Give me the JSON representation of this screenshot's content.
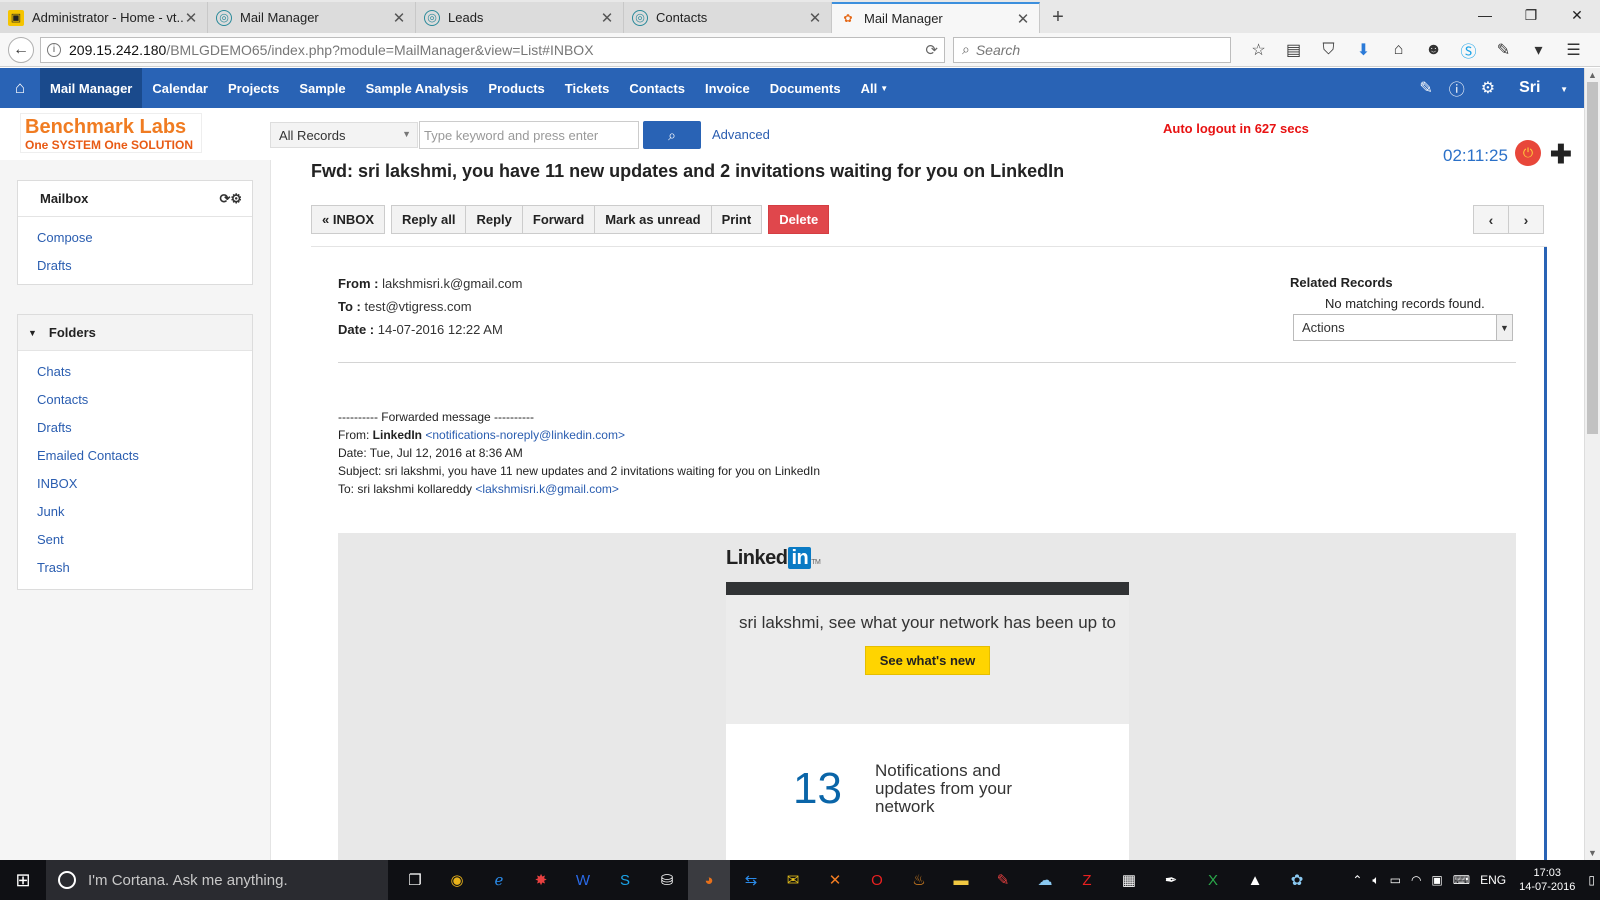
{
  "browser": {
    "tabs": [
      {
        "label": "Administrator - Home - vt...",
        "icon": "vtiger-icon",
        "active": false
      },
      {
        "label": "Mail Manager",
        "icon": "globe-icon",
        "active": false
      },
      {
        "label": "Leads",
        "icon": "globe-icon",
        "active": false
      },
      {
        "label": "Contacts",
        "icon": "globe-icon",
        "active": false
      },
      {
        "label": "Mail Manager",
        "icon": "crm-icon",
        "active": true
      }
    ],
    "url_host": "209.15.242.180",
    "url_path": "/BMLGDEMO65/index.php?module=MailManager&view=List#INBOX",
    "search_placeholder": "Search"
  },
  "appnav": {
    "items": [
      "Mail Manager",
      "Calendar",
      "Projects",
      "Sample",
      "Sample Analysis",
      "Products",
      "Tickets",
      "Contacts",
      "Invoice",
      "Documents",
      "All"
    ],
    "active": "Mail Manager",
    "user": "Sri"
  },
  "header": {
    "logo_line1": "Benchmark Labs",
    "logo_line2": "One SYSTEM One SOLUTION",
    "records_select": "All Records",
    "keyword_placeholder": "Type keyword and press enter",
    "advanced_label": "Advanced",
    "auto_logout": "Auto logout in 627 secs",
    "timer": "02:11:25"
  },
  "sidebar": {
    "mailbox_title": "Mailbox",
    "mailbox_items": [
      "Compose",
      "Drafts"
    ],
    "folders_title": "Folders",
    "folders": [
      "Chats",
      "Contacts",
      "Drafts",
      "Emailed Contacts",
      "INBOX",
      "Junk",
      "Sent",
      "Trash"
    ]
  },
  "mail": {
    "subject": "Fwd: sri lakshmi, you have 11 new updates and 2 invitations waiting for you on LinkedIn",
    "actions": {
      "back": "« INBOX",
      "reply_all": "Reply all",
      "reply": "Reply",
      "forward": "Forward",
      "mark_unread": "Mark as unread",
      "print": "Print",
      "delete": "Delete"
    },
    "from_label": "From :",
    "from": "lakshmisri.k@gmail.com",
    "to_label": "To :",
    "to": "test@vtigress.com",
    "date_label": "Date :",
    "date": "14-07-2016 12:22 AM",
    "related_title": "Related Records",
    "related_empty": "No matching records found.",
    "related_actions": "Actions",
    "forwarded": {
      "marker": "---------- Forwarded message ----------",
      "from_prefix": "From: ",
      "from_name": "LinkedIn",
      "from_email": "<notifications-noreply@linkedin.com>",
      "date_line": "Date: Tue, Jul 12, 2016 at 8:36 AM",
      "subject_line": "Subject: sri lakshmi, you have 11 new updates and 2 invitations waiting for you on LinkedIn",
      "to_prefix": "To: sri lakshmi kollareddy ",
      "to_email": "<lakshmisri.k@gmail.com>"
    },
    "linkedin": {
      "logo_text": "Linked",
      "logo_in": "in",
      "logo_tm": "TM",
      "headline": "sri lakshmi, see what your network has been up to",
      "cta": "See what's new",
      "count": "13",
      "count_text": "Notifications and updates from your network"
    }
  },
  "taskbar": {
    "cortana": "I'm Cortana. Ask me anything.",
    "lang": "ENG",
    "time": "17:03",
    "date": "14-07-2016"
  },
  "colors": {
    "nav_blue": "#2963b5",
    "delete_red": "#e0474c",
    "logout_red": "#e81212",
    "logo_orange": "#f07c22",
    "linkedin_blue": "#0a7ac4",
    "cta_yellow": "#ffd400"
  }
}
